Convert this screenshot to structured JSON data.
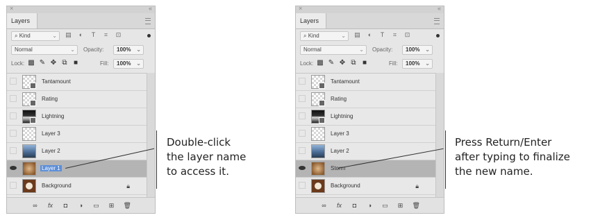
{
  "panels": [
    {
      "window": {
        "close": "×",
        "collapse": "«"
      },
      "tab": "Layers",
      "filter": {
        "kind_label": "Kind",
        "icons": [
          "pixel-filter-icon",
          "adjustment-filter-icon",
          "type-filter-icon",
          "shape-filter-icon",
          "smart-object-filter-icon"
        ]
      },
      "blend_mode": "Normal",
      "opacity_label": "Opacity:",
      "opacity_value": "100%",
      "lock_label": "Lock:",
      "fill_label": "Fill:",
      "fill_value": "100%",
      "layers": [
        {
          "name": "Tantamount",
          "visible": false,
          "thumb": "checker",
          "badge": true
        },
        {
          "name": "Rating",
          "visible": false,
          "thumb": "checker",
          "badge": true
        },
        {
          "name": "Lightning",
          "visible": false,
          "thumb": "dark",
          "badge": true
        },
        {
          "name": "Layer 3",
          "visible": false,
          "thumb": "checker",
          "badge": false
        },
        {
          "name": "Layer 2",
          "visible": false,
          "thumb": "sky",
          "badge": false
        },
        {
          "name": "Layer 1",
          "visible": true,
          "thumb": "warm",
          "badge": false,
          "selected": true,
          "editing": true
        },
        {
          "name": "Background",
          "visible": false,
          "thumb": "bg",
          "badge": false,
          "locked": true
        }
      ]
    },
    {
      "window": {
        "close": "×",
        "collapse": "«"
      },
      "tab": "Layers",
      "filter": {
        "kind_label": "Kind",
        "icons": [
          "pixel-filter-icon",
          "adjustment-filter-icon",
          "type-filter-icon",
          "shape-filter-icon",
          "smart-object-filter-icon"
        ]
      },
      "blend_mode": "Normal",
      "opacity_label": "Opacity:",
      "opacity_value": "100%",
      "lock_label": "Lock:",
      "fill_label": "Fill:",
      "fill_value": "100%",
      "layers": [
        {
          "name": "Tantamount",
          "visible": false,
          "thumb": "checker",
          "badge": true
        },
        {
          "name": "Rating",
          "visible": false,
          "thumb": "checker",
          "badge": true
        },
        {
          "name": "Lightning",
          "visible": false,
          "thumb": "dark",
          "badge": true
        },
        {
          "name": "Layer 3",
          "visible": false,
          "thumb": "checker",
          "badge": false
        },
        {
          "name": "Layer 2",
          "visible": false,
          "thumb": "sky",
          "badge": false
        },
        {
          "name": "Storm",
          "visible": true,
          "thumb": "warm",
          "badge": false,
          "selected": true
        },
        {
          "name": "Background",
          "visible": false,
          "thumb": "bg",
          "badge": false,
          "locked": true
        }
      ]
    }
  ],
  "callouts": [
    {
      "lines": [
        "Double-click",
        "the layer name",
        "to access it."
      ]
    },
    {
      "lines": [
        "Press Return/Enter",
        "after typing to finalize",
        "the new name."
      ]
    }
  ],
  "colors": {
    "selection": "#b4b4b4",
    "text_highlight": "#5d8fd8"
  }
}
